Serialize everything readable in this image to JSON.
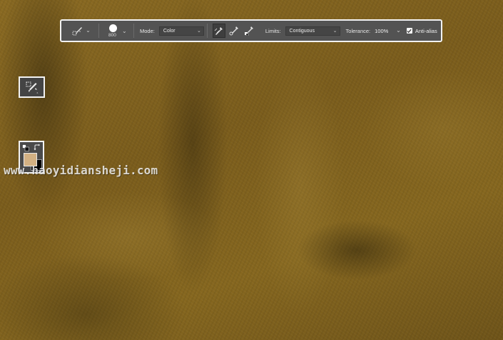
{
  "options_bar": {
    "tool_preset_icon": "color-replacement-tool-icon",
    "brush": {
      "size": "800"
    },
    "mode": {
      "label": "Mode:",
      "value": "Color"
    },
    "sampling": [
      {
        "icon": "sampling-continuous-icon",
        "active": true
      },
      {
        "icon": "sampling-once-icon",
        "active": false
      },
      {
        "icon": "sampling-background-swatch-icon",
        "active": false
      }
    ],
    "limits": {
      "label": "Limits:",
      "value": "Contiguous"
    },
    "tolerance": {
      "label": "Tolerance:",
      "value": "100%"
    },
    "anti_alias": {
      "label": "Anti-alias",
      "checked": true
    }
  },
  "tool_icon": "color-replacement-tool-icon",
  "colors": {
    "foreground": "#d3b183",
    "background": "#000000"
  },
  "watermark": "www.haoyidiansheji.com"
}
